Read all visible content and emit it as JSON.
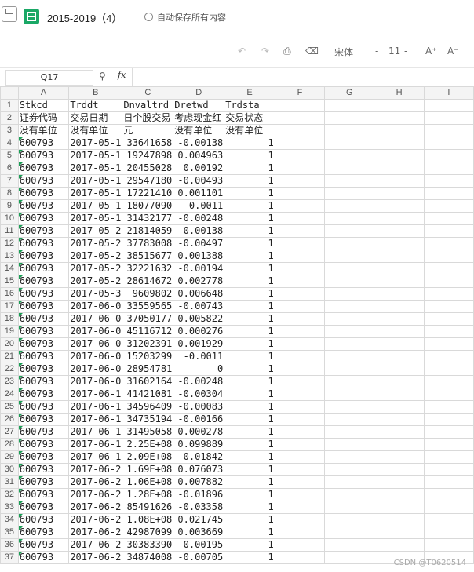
{
  "app": {
    "doc_title": "2015-2019（4）",
    "autosave_label": "自动保存所有内容"
  },
  "toolbar": {
    "undo_icon": "undo-icon",
    "redo_icon": "redo-icon",
    "format_painter_icon": "format-painter-icon",
    "eraser_icon": "eraser-icon",
    "font_name": "宋体",
    "font_size": "11",
    "font_increase": "A⁺",
    "font_decrease": "A⁻"
  },
  "formula_bar": {
    "cell_ref": "Q17",
    "fx_label": "fx",
    "value": ""
  },
  "sheet": {
    "columns": [
      "A",
      "B",
      "C",
      "D",
      "E",
      "F",
      "G",
      "H",
      "I"
    ],
    "rows": [
      [
        "1",
        "Stkcd",
        "Trddt",
        "Dnvaltrd",
        "Dretwd",
        "Trdsta"
      ],
      [
        "2",
        "证券代码",
        "交易日期",
        "日个股交易",
        "考虑现金红",
        "交易状态"
      ],
      [
        "3",
        "没有单位",
        "没有单位",
        "元",
        "没有单位",
        "没有单位"
      ],
      [
        "4",
        "600793",
        "2017-05-1",
        "33641658",
        "-0.00138",
        "1"
      ],
      [
        "5",
        "600793",
        "2017-05-1",
        "19247898",
        "0.004963",
        "1"
      ],
      [
        "6",
        "600793",
        "2017-05-1",
        "20455028",
        "0.00192",
        "1"
      ],
      [
        "7",
        "600793",
        "2017-05-1",
        "29547180",
        "-0.00493",
        "1"
      ],
      [
        "8",
        "600793",
        "2017-05-1",
        "17221410",
        "0.001101",
        "1"
      ],
      [
        "9",
        "600793",
        "2017-05-1",
        "18077090",
        "-0.0011",
        "1"
      ],
      [
        "10",
        "600793",
        "2017-05-1",
        "31432177",
        "-0.00248",
        "1"
      ],
      [
        "11",
        "600793",
        "2017-05-2",
        "21814059",
        "-0.00138",
        "1"
      ],
      [
        "12",
        "600793",
        "2017-05-2",
        "37783008",
        "-0.00497",
        "1"
      ],
      [
        "13",
        "600793",
        "2017-05-2",
        "38515677",
        "0.001388",
        "1"
      ],
      [
        "14",
        "600793",
        "2017-05-2",
        "32221632",
        "-0.00194",
        "1"
      ],
      [
        "15",
        "600793",
        "2017-05-2",
        "28614672",
        "0.002778",
        "1"
      ],
      [
        "16",
        "600793",
        "2017-05-3",
        "9609802",
        "0.006648",
        "1"
      ],
      [
        "17",
        "600793",
        "2017-06-0",
        "33559565",
        "-0.00743",
        "1"
      ],
      [
        "18",
        "600793",
        "2017-06-0",
        "37050177",
        "0.005822",
        "1"
      ],
      [
        "19",
        "600793",
        "2017-06-0",
        "45116712",
        "0.000276",
        "1"
      ],
      [
        "20",
        "600793",
        "2017-06-0",
        "31202391",
        "0.001929",
        "1"
      ],
      [
        "21",
        "600793",
        "2017-06-0",
        "15203299",
        "-0.0011",
        "1"
      ],
      [
        "22",
        "600793",
        "2017-06-0",
        "28954781",
        "0",
        "1"
      ],
      [
        "23",
        "600793",
        "2017-06-0",
        "31602164",
        "-0.00248",
        "1"
      ],
      [
        "24",
        "600793",
        "2017-06-1",
        "41421081",
        "-0.00304",
        "1"
      ],
      [
        "25",
        "600793",
        "2017-06-1",
        "34596409",
        "-0.00083",
        "1"
      ],
      [
        "26",
        "600793",
        "2017-06-1",
        "34735194",
        "-0.00166",
        "1"
      ],
      [
        "27",
        "600793",
        "2017-06-1",
        "31495058",
        "0.000278",
        "1"
      ],
      [
        "28",
        "600793",
        "2017-06-1",
        "2.25E+08",
        "0.099889",
        "1"
      ],
      [
        "29",
        "600793",
        "2017-06-1",
        "2.09E+08",
        "-0.01842",
        "1"
      ],
      [
        "30",
        "600793",
        "2017-06-2",
        "1.69E+08",
        "0.076073",
        "1"
      ],
      [
        "31",
        "600793",
        "2017-06-2",
        "1.06E+08",
        "0.007882",
        "1"
      ],
      [
        "32",
        "600793",
        "2017-06-2",
        "1.28E+08",
        "-0.01896",
        "1"
      ],
      [
        "33",
        "600793",
        "2017-06-2",
        "85491626",
        "-0.03358",
        "1"
      ],
      [
        "34",
        "600793",
        "2017-06-2",
        "1.08E+08",
        "0.021745",
        "1"
      ],
      [
        "35",
        "600793",
        "2017-06-2",
        "42987099",
        "0.003669",
        "1"
      ],
      [
        "36",
        "600793",
        "2017-06-2",
        "30383390",
        "0.00195",
        "1"
      ],
      [
        "37",
        "600793",
        "2017-06-2",
        "34874008",
        "-0.00705",
        "1"
      ]
    ]
  },
  "watermark": "CSDN @T0620514"
}
